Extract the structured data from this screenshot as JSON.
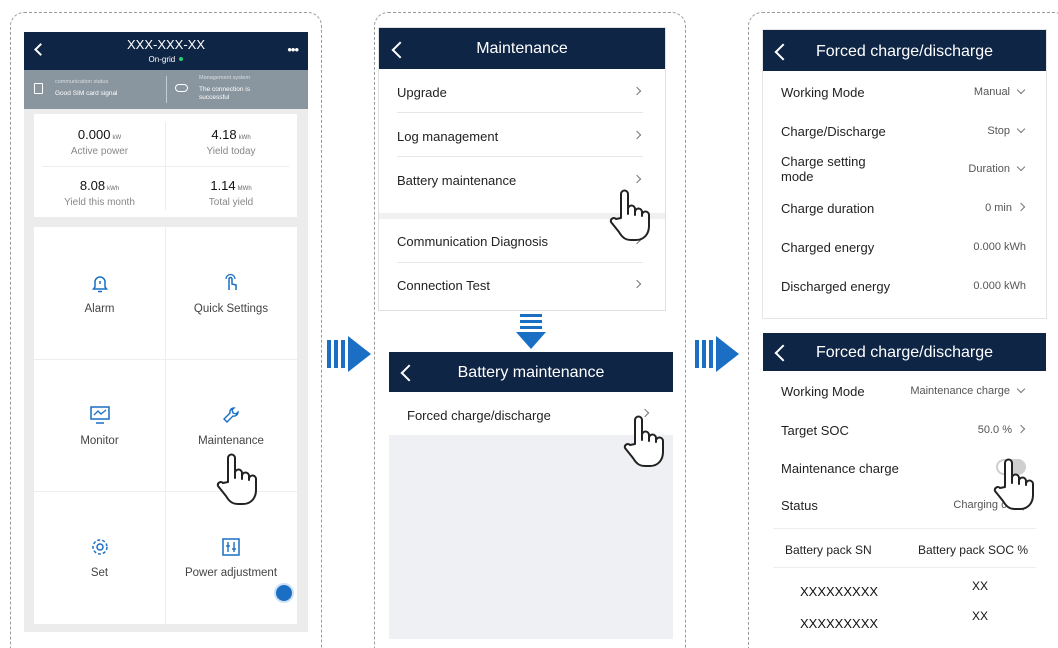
{
  "screen1": {
    "device_title": "XXX-XXX-XX",
    "status": "On-grid",
    "comm_label": "communication status",
    "comm_value": "Good SIM card signal",
    "mgmt_label": "Management system",
    "mgmt_value": "The connection is successful",
    "stats": [
      {
        "value": "0.000",
        "unit": "kW",
        "label": "Active power"
      },
      {
        "value": "4.18",
        "unit": "kWh",
        "label": "Yield today"
      },
      {
        "value": "8.08",
        "unit": "kWh",
        "label": "Yield this month"
      },
      {
        "value": "1.14",
        "unit": "MWh",
        "label": "Total yield"
      }
    ],
    "tiles": [
      "Alarm",
      "Quick Settings",
      "Monitor",
      "Maintenance",
      "Set",
      "Power adjustment"
    ]
  },
  "screen2": {
    "title": "Maintenance",
    "items": [
      "Upgrade",
      "Log management",
      "Battery maintenance",
      "Communication Diagnosis",
      "Connection Test"
    ]
  },
  "screen3": {
    "title": "Battery maintenance",
    "item": "Forced charge/discharge"
  },
  "screen4": {
    "title": "Forced charge/discharge",
    "rows": [
      {
        "label": "Working Mode",
        "value": "Manual"
      },
      {
        "label": "Charge/Discharge",
        "value": "Stop"
      },
      {
        "label": "Charge setting mode",
        "value": "Duration"
      },
      {
        "label": "Charge duration",
        "value": "0 min"
      },
      {
        "label": "Charged energy",
        "value": "0.000 kWh"
      },
      {
        "label": "Discharged energy",
        "value": "0.000 kWh"
      }
    ]
  },
  "screen5": {
    "title": "Forced charge/discharge",
    "rows": [
      {
        "label": "Working Mode",
        "value": "Maintenance charge"
      },
      {
        "label": "Target SOC",
        "value": "50.0 %"
      },
      {
        "label": "Maintenance charge",
        "value": ""
      },
      {
        "label": "Status",
        "value": "Charging comp"
      }
    ],
    "table_headers": [
      "Battery pack SN",
      "Battery pack SOC %"
    ],
    "table_rows": [
      [
        "XXXXXXXXX",
        "XX"
      ],
      [
        "XXXXXXXXX",
        "XX"
      ]
    ]
  },
  "colors": {
    "navy": "#0f2545",
    "arrow": "#1a6fc4",
    "green": "#2ecc71"
  }
}
